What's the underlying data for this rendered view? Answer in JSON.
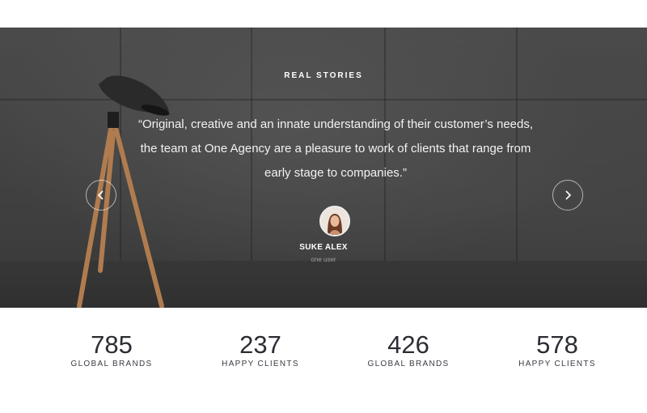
{
  "testimonials": {
    "eyebrow": "REAL STORIES",
    "quote": "“Original, creative and an innate understanding of their customer’s needs, the team at One Agency are a pleasure to work of clients that range from early stage to companies.”",
    "author": {
      "name": "SUKE ALEX",
      "role": "one user"
    },
    "prev_icon": "chevron-left-icon",
    "next_icon": "chevron-right-icon"
  },
  "stats": [
    {
      "value": "785",
      "label": "GLOBAL BRANDS"
    },
    {
      "value": "237",
      "label": "HAPPY CLIENTS"
    },
    {
      "value": "426",
      "label": "GLOBAL BRANDS"
    },
    {
      "value": "578",
      "label": "HAPPY CLIENTS"
    }
  ],
  "colors": {
    "text_dark": "#2b2d33",
    "hero_text": "#ffffff",
    "lamp_wood": "#b07c4f",
    "lamp_shade": "#2a2a2a"
  }
}
